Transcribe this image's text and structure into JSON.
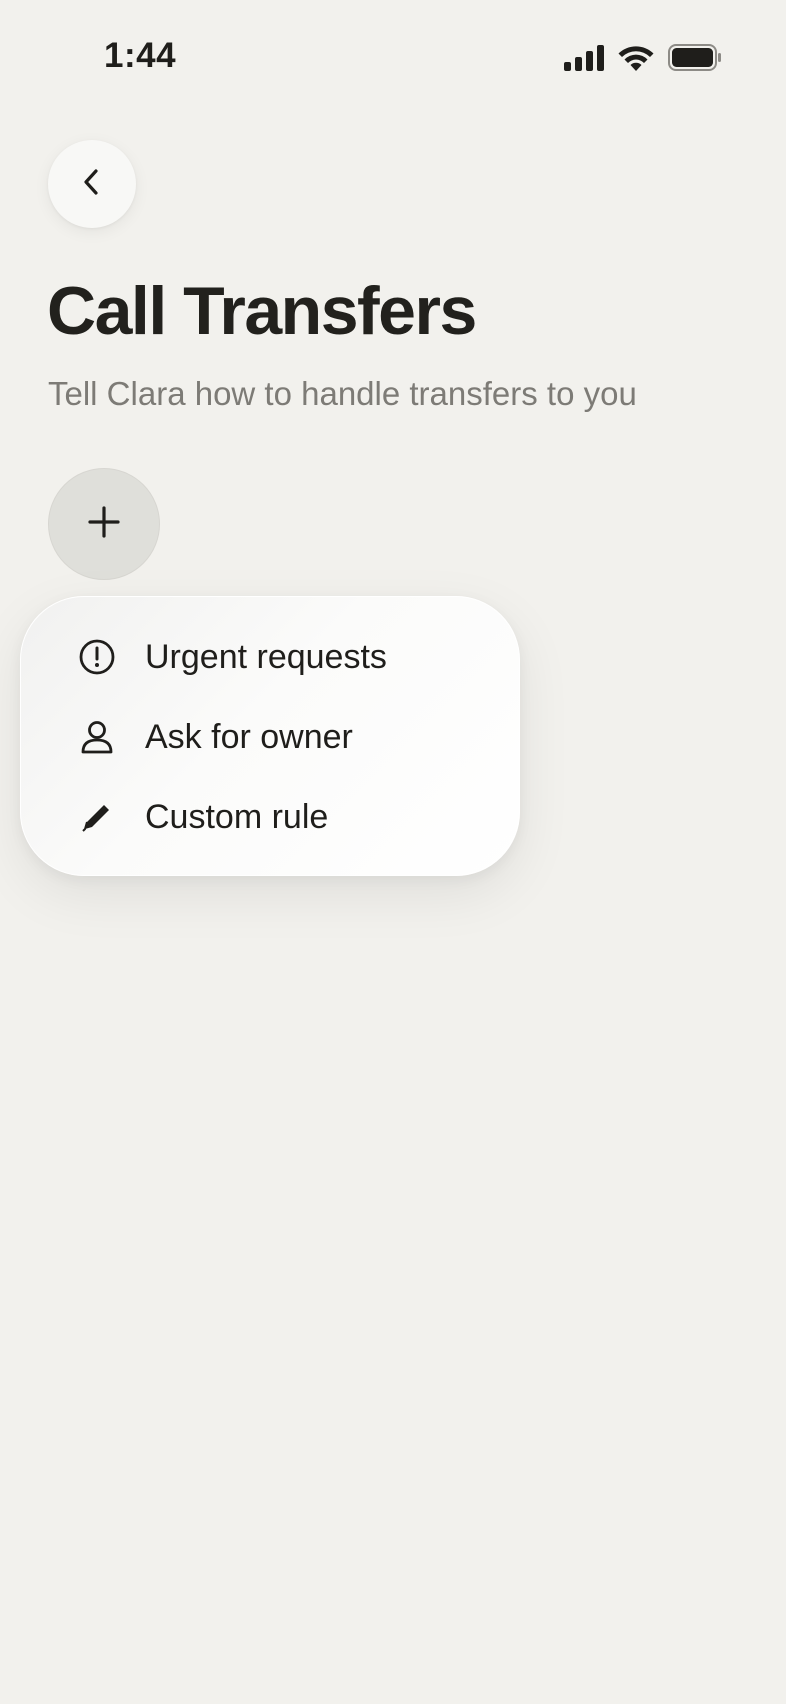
{
  "status_bar": {
    "time": "1:44",
    "icons": [
      "cellular-signal-icon",
      "wifi-icon",
      "battery-icon"
    ]
  },
  "header": {
    "back_icon": "chevron-left-icon",
    "title": "Call Transfers",
    "subtitle": "Tell Clara how to handle transfers to you"
  },
  "add_button": {
    "icon": "plus-icon"
  },
  "menu": {
    "items": [
      {
        "label": "Urgent requests",
        "icon": "alert-circle-icon"
      },
      {
        "label": "Ask for owner",
        "icon": "person-icon"
      },
      {
        "label": "Custom rule",
        "icon": "pencil-icon"
      }
    ]
  },
  "colors": {
    "background": "#f2f1ed",
    "text_primary": "#1f1e1b",
    "text_secondary": "#7d7b76",
    "add_button_bg": "#dfdfda",
    "menu_bg": "#ffffff"
  }
}
